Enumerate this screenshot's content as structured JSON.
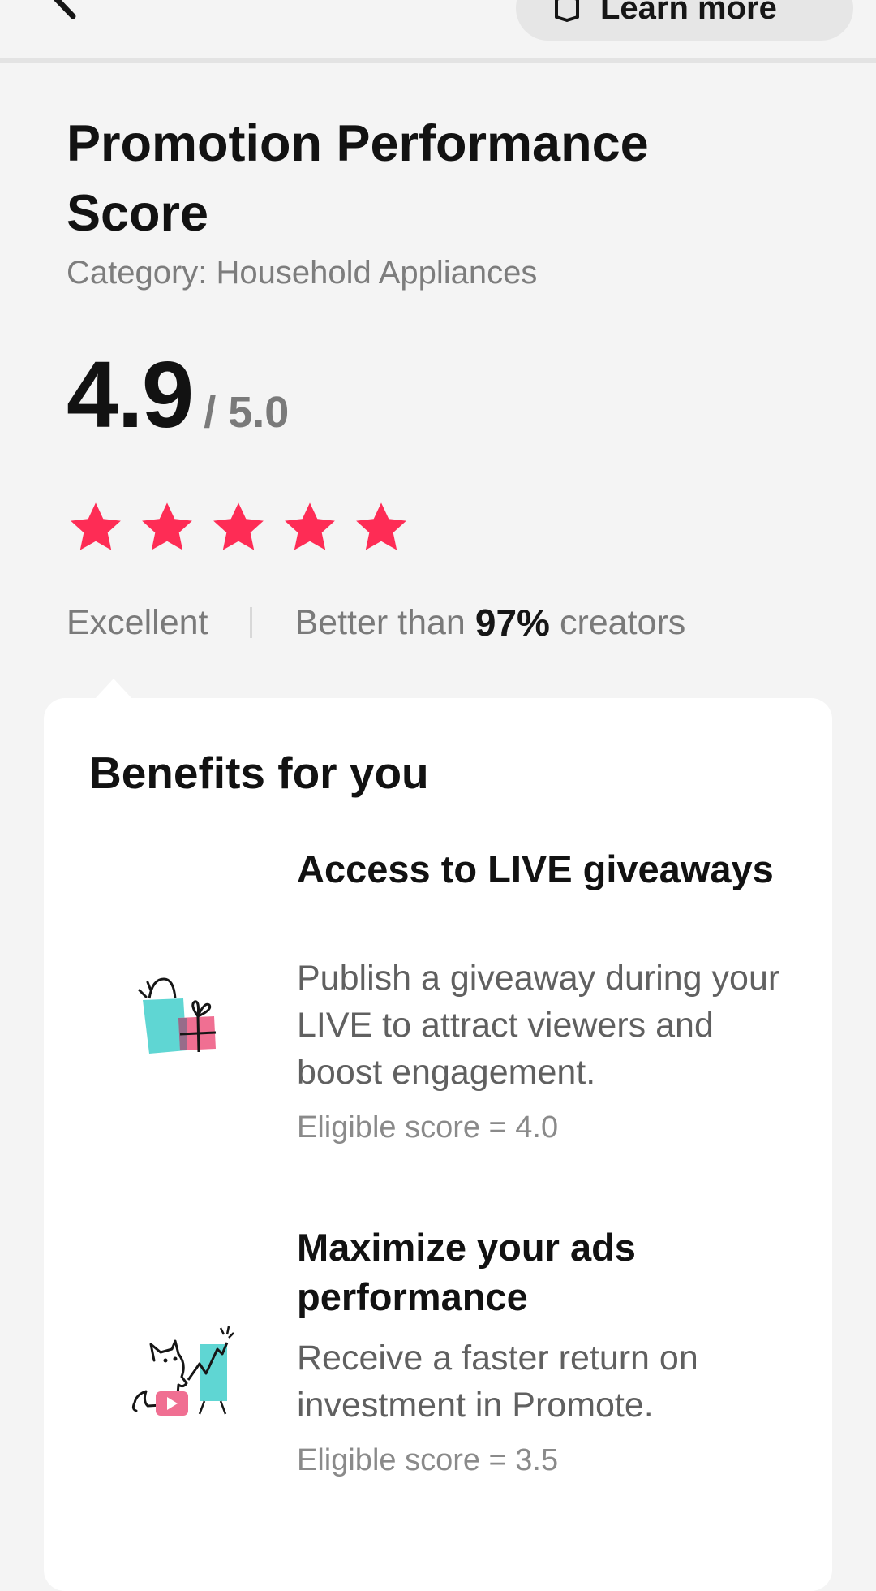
{
  "header": {
    "learn_more_label": "Learn more"
  },
  "page": {
    "title": "Promotion Performance Score",
    "category": "Category: Household Appliances"
  },
  "score": {
    "value": "4.9",
    "max": "/ 5.0",
    "stars_filled": 5,
    "stars_total": 5,
    "star_color": "#fe2c55"
  },
  "rating": {
    "label": "Excellent",
    "better_prefix": "Better than",
    "better_percent": "97%",
    "better_suffix": "creators"
  },
  "benefits": {
    "title": "Benefits for you",
    "items": [
      {
        "title": "Access to LIVE giveaways",
        "description": "Publish a giveaway during your LIVE to attract viewers and boost engagement.",
        "eligibility": "Eligible score = 4.0",
        "icon": "shopping-bag-gift-icon"
      },
      {
        "title": "Maximize your ads performance",
        "description": "Receive a faster return on investment in Promote.",
        "eligibility": "Eligible score = 3.5",
        "icon": "dog-chart-presentation-icon"
      }
    ]
  },
  "colors": {
    "accent": "#fe2c55",
    "teal": "#5fd6d3",
    "pink": "#f06f92"
  }
}
